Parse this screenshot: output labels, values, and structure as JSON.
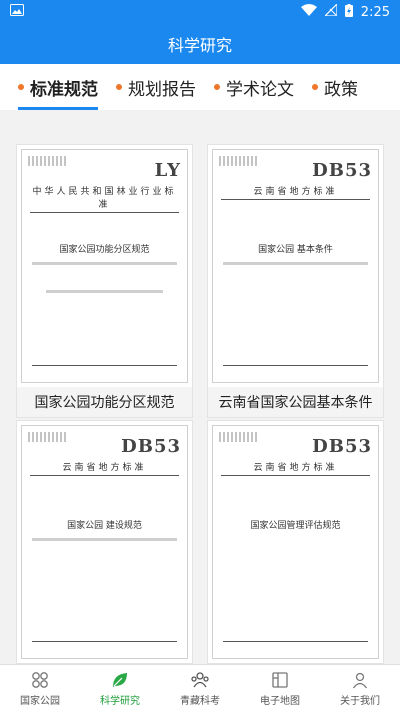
{
  "status": {
    "time": "2:25"
  },
  "app": {
    "title": "科学研究"
  },
  "tabs": [
    {
      "label": "标准规范",
      "active": true
    },
    {
      "label": "规划报告",
      "active": false
    },
    {
      "label": "学术论文",
      "active": false
    },
    {
      "label": "政策",
      "active": false
    }
  ],
  "cards": [
    {
      "caption": "国家公园功能分区规范",
      "code": "LY",
      "header": "中华人民共和国林业行业标准",
      "doc_title": "国家公园功能分区规范"
    },
    {
      "caption": "云南省国家公园基本条件",
      "code": "DB53",
      "header": "云南省地方标准",
      "doc_title": "国家公园 基本条件"
    },
    {
      "caption": "",
      "code": "DB53",
      "header": "云南省地方标准",
      "doc_title": "国家公园 建设规范"
    },
    {
      "caption": "",
      "code": "DB53",
      "header": "云南省地方标准",
      "doc_title": "国家公园管理评估规范"
    }
  ],
  "nav": [
    {
      "label": "国家公园",
      "icon": "grid-icon",
      "active": false
    },
    {
      "label": "科学研究",
      "icon": "leaf-icon",
      "active": true
    },
    {
      "label": "青藏科考",
      "icon": "people-icon",
      "active": false
    },
    {
      "label": "电子地图",
      "icon": "map-icon",
      "active": false
    },
    {
      "label": "关于我们",
      "icon": "person-icon",
      "active": false
    }
  ],
  "colors": {
    "primary": "#1b88f0",
    "accent_dot": "#f0772a",
    "nav_active": "#1f9e3b"
  }
}
